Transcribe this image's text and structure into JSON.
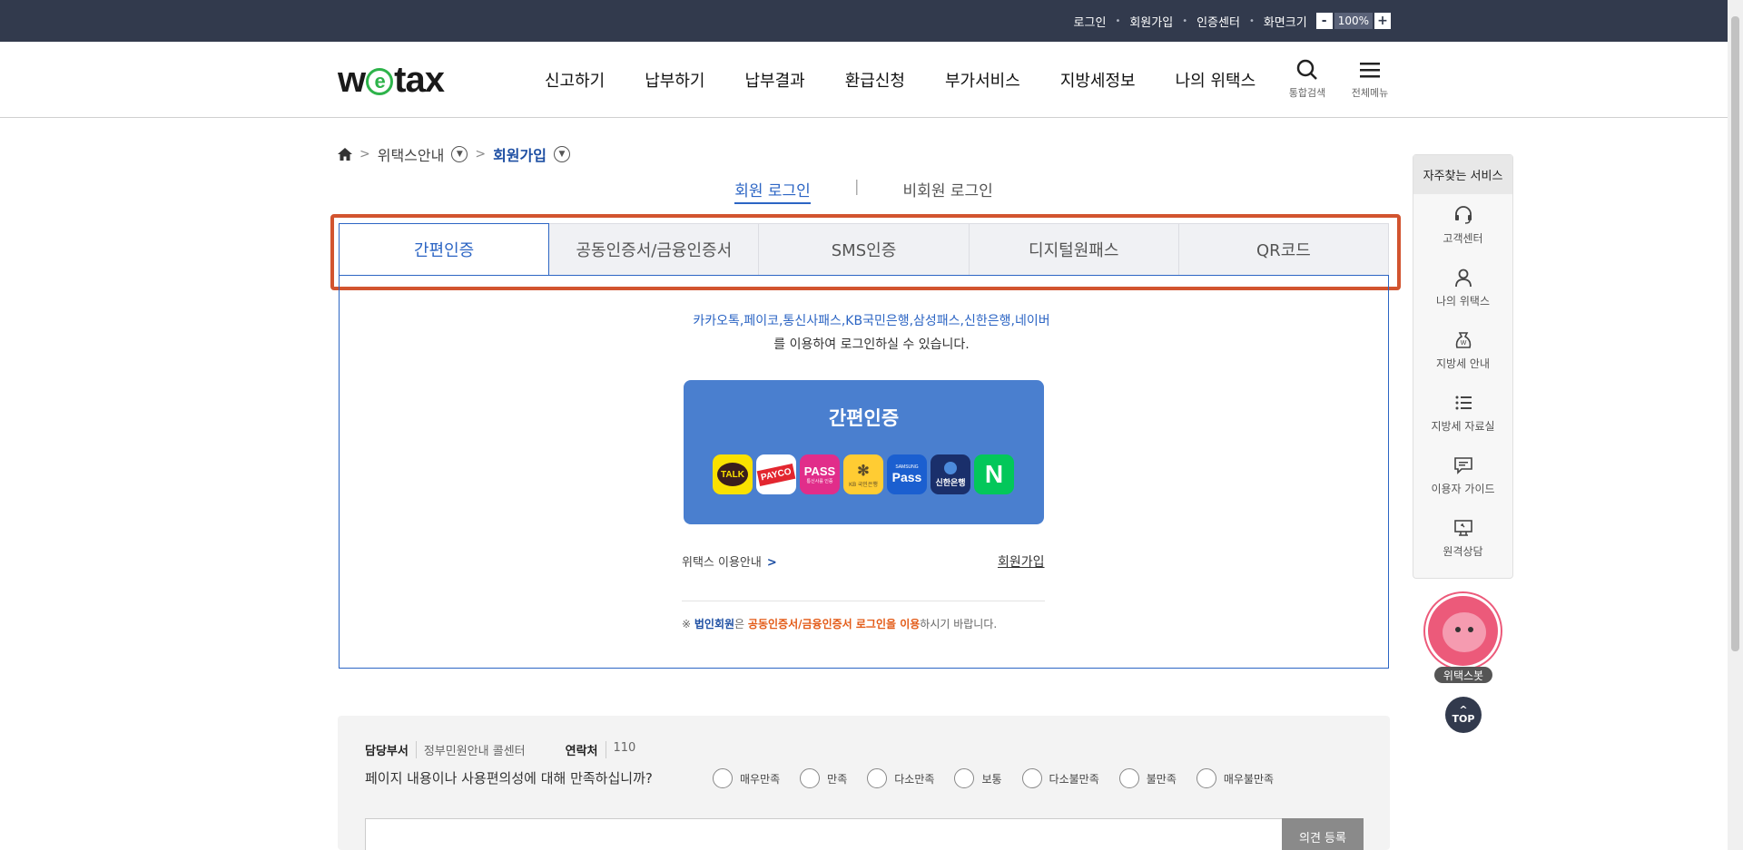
{
  "topbar": {
    "login": "로그인",
    "signup": "회원가입",
    "cert_center": "인증센터",
    "screen_size": "화면크기",
    "zoom_minus": "-",
    "zoom_value": "100%",
    "zoom_plus": "+"
  },
  "header": {
    "logo_w": "w",
    "logo_e": "e",
    "logo_tax": "tax",
    "nav": [
      "신고하기",
      "납부하기",
      "납부결과",
      "환급신청",
      "부가서비스",
      "지방세정보",
      "나의 위택스"
    ],
    "search_label": "통합검색",
    "menu_label": "전체메뉴"
  },
  "breadcrumb": {
    "level1": "위택스안내",
    "level2": "회원가입"
  },
  "login_type": {
    "member": "회원 로그인",
    "separator": "|",
    "nonmember": "비회원 로그인"
  },
  "auth_tabs": [
    "간편인증",
    "공동인증서/금융인증서",
    "SMS인증",
    "디지털원패스",
    "QR코드"
  ],
  "panel": {
    "providers": "카카오톡,페이코,통신사패스,KB국민은행,삼성패스,신한은행,네이버",
    "providers_suffix": "를 이용하여 로그인하실 수 있습니다.",
    "card_title": "간편인증",
    "apps": {
      "kakao": "TALK",
      "payco": "PAYCO",
      "pass": "PASS",
      "pass_sub": "통신사를 인증",
      "kb_sub": "KB 국민은행",
      "samsung_top": "SAMSUNG",
      "samsung": "Pass",
      "shinhan": "신한은행",
      "naver": "N"
    },
    "guide_link": "위택스 이용안내",
    "join_link": "회원가입",
    "notice_prefix": "※ ",
    "notice_corp": "법인회원",
    "notice_mid": "은 ",
    "notice_cert": "공동인증서/금융인증서 로그인을 이용",
    "notice_suffix": "하시기 바랍니다."
  },
  "feedback": {
    "dept_label": "담당부서",
    "dept_value": "정부민원안내 콜센터",
    "contact_label": "연락처",
    "contact_value": "110",
    "question": "페이지 내용이나 사용편의성에 대해 만족하십니까?",
    "options": [
      "매우만족",
      "만족",
      "다소만족",
      "보통",
      "다소불만족",
      "불만족",
      "매우불만족"
    ],
    "submit": "의견 등록"
  },
  "quick_menu": {
    "title": "자주찾는 서비스",
    "items": [
      "고객센터",
      "나의 위택스",
      "지방세 안내",
      "지방세 자료실",
      "이용자 가이드",
      "원격상담"
    ]
  },
  "bot_label": "위택스봇",
  "top_button": "TOP",
  "colors": {
    "topbar": "#323a4d",
    "primary": "#2c65c4",
    "card": "#4a7fcf",
    "highlight": "#d2542f"
  }
}
